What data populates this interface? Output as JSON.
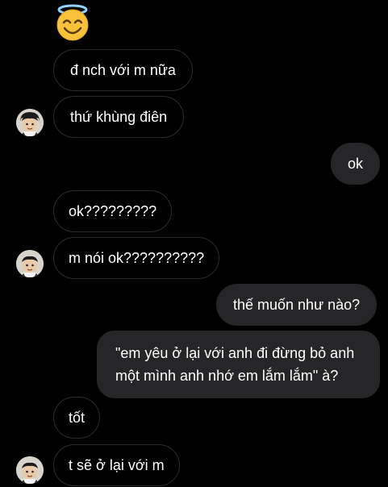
{
  "chat": {
    "icons": {
      "reaction_emoji": "smiling-face-with-halo-icon",
      "avatar": "contact-avatar"
    },
    "colors": {
      "background": "#000000",
      "incoming_border": "#2b2b2d",
      "outgoing_bubble": "#262629",
      "text": "#ffffff",
      "emoji_face": "#f7c23a",
      "halo": "#8fd3ff"
    },
    "messages": [
      {
        "side": "incoming",
        "text": "đ nch với m nữa"
      },
      {
        "side": "incoming",
        "text": "thứ khùng điên"
      },
      {
        "side": "outgoing",
        "text": "ok"
      },
      {
        "side": "incoming",
        "text": "ok?????????"
      },
      {
        "side": "incoming",
        "text": "m nói ok??????????"
      },
      {
        "side": "outgoing",
        "text": "thế muốn như nào?"
      },
      {
        "side": "outgoing",
        "text": "\"em yêu ở lại với anh đi đừng bỏ anh một mình anh nhớ em lắm lắm\" à?"
      },
      {
        "side": "incoming",
        "text": "tốt"
      },
      {
        "side": "incoming",
        "text": "t sẽ ở lại với m"
      }
    ]
  }
}
